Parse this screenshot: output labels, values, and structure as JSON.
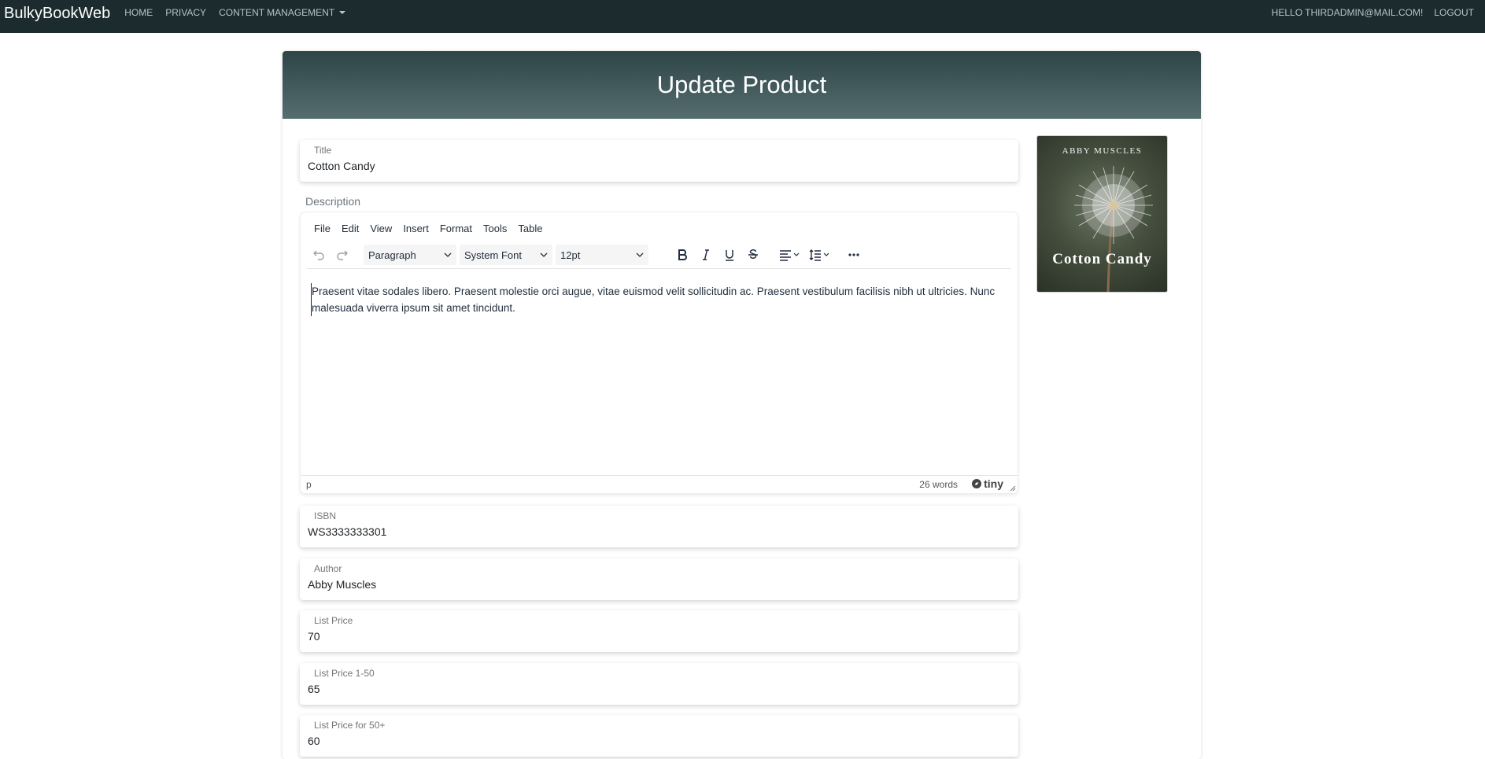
{
  "navbar": {
    "brand": "BulkyBookWeb",
    "links": [
      {
        "label": "Home"
      },
      {
        "label": "Privacy"
      },
      {
        "label": "Content Management"
      }
    ],
    "greeting": "Hello thirdadmin@mail.com!",
    "logout": "Logout"
  },
  "page": {
    "title": "Update Product"
  },
  "fields": {
    "title": {
      "label": "Title",
      "value": "Cotton Candy"
    },
    "isbn": {
      "label": "ISBN",
      "value": "WS3333333301"
    },
    "author": {
      "label": "Author",
      "value": "Abby Muscles"
    },
    "list_price": {
      "label": "List Price",
      "value": "70"
    },
    "price_1_50": {
      "label": "List Price 1-50",
      "value": "65"
    },
    "price_50_plus": {
      "label": "List Price for 50+",
      "value": "60"
    }
  },
  "description": {
    "label": "Description",
    "menus": [
      "File",
      "Edit",
      "View",
      "Insert",
      "Format",
      "Tools",
      "Table"
    ],
    "block_format": "Paragraph",
    "font_family": "System Font",
    "font_size": "12pt",
    "content": "Praesent vitae sodales libero. Praesent molestie orci augue, vitae euismod velit sollicitudin ac. Praesent vestibulum facilisis nibh ut ultricies. Nunc malesuada viverra ipsum sit amet tincidunt.",
    "status_path": "p",
    "word_count": "26 words",
    "brand": "tiny"
  },
  "cover": {
    "author": "ABBY MUSCLES",
    "title": "Cotton Candy"
  }
}
